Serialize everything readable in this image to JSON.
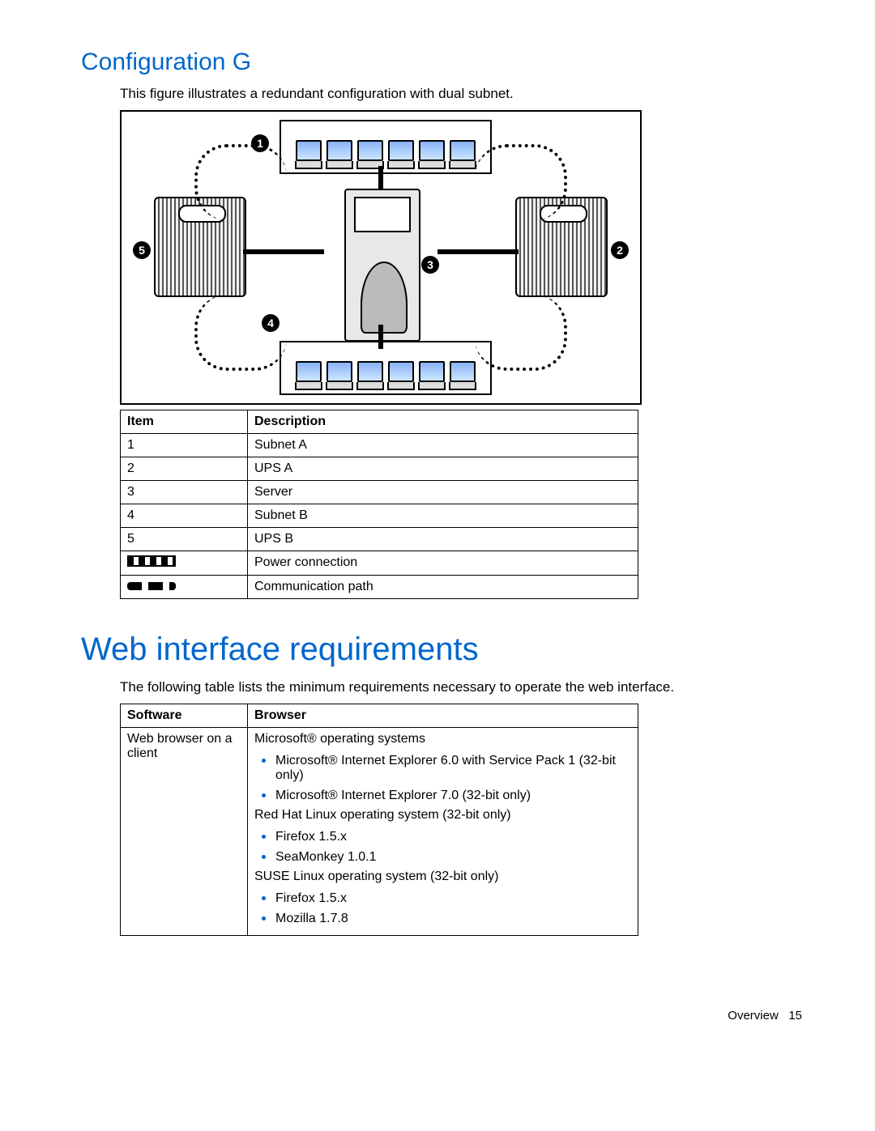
{
  "section1": {
    "title": "Configuration G",
    "intro": "This figure illustrates a redundant configuration with dual subnet.",
    "callouts": {
      "c1": "1",
      "c2": "2",
      "c3": "3",
      "c4": "4",
      "c5": "5"
    }
  },
  "legend": {
    "headers": {
      "item": "Item",
      "desc": "Description"
    },
    "rows": [
      {
        "item": "1",
        "desc": "Subnet A"
      },
      {
        "item": "2",
        "desc": "UPS A"
      },
      {
        "item": "3",
        "desc": "Server"
      },
      {
        "item": "4",
        "desc": "Subnet B"
      },
      {
        "item": "5",
        "desc": "UPS B"
      }
    ],
    "power_desc": "Power connection",
    "comm_desc": "Communication path"
  },
  "section2": {
    "title": "Web interface requirements",
    "intro": "The following table lists the minimum requirements necessary to operate the web interface."
  },
  "req": {
    "headers": {
      "software": "Software",
      "browser": "Browser"
    },
    "software_label": "Web browser on a client",
    "ms_heading": "Microsoft® operating systems",
    "ms_items": [
      "Microsoft® Internet Explorer 6.0 with Service Pack 1 (32-bit only)",
      "Microsoft® Internet Explorer 7.0 (32-bit only)"
    ],
    "rh_heading": "Red Hat Linux operating system (32-bit only)",
    "rh_items": [
      "Firefox 1.5.x",
      "SeaMonkey 1.0.1"
    ],
    "suse_heading": "SUSE Linux operating system (32-bit only)",
    "suse_items": [
      "Firefox 1.5.x",
      "Mozilla 1.7.8"
    ]
  },
  "footer": {
    "section": "Overview",
    "page": "15"
  }
}
